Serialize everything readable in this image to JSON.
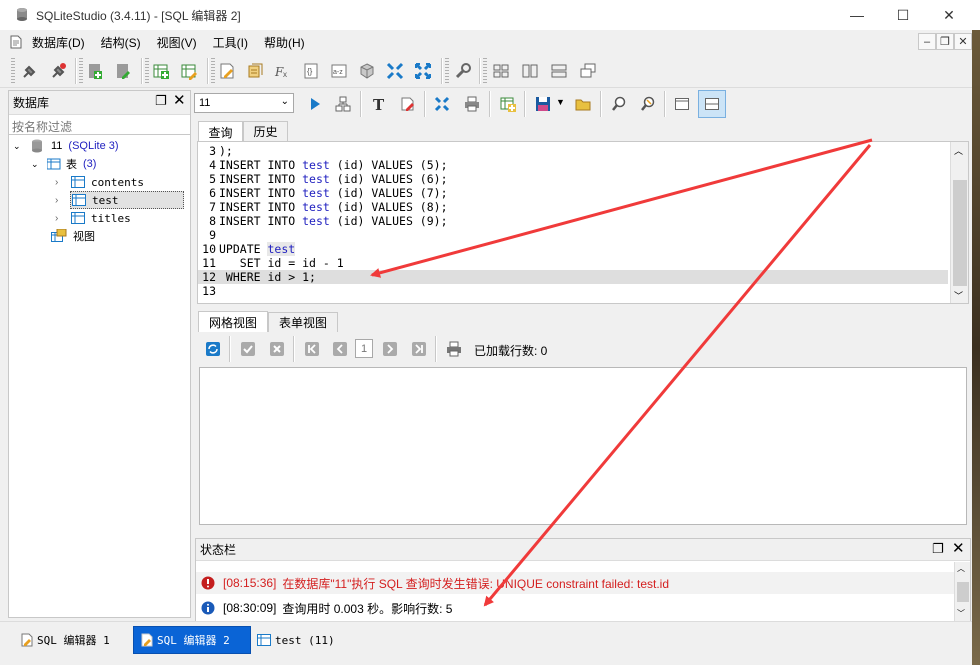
{
  "window": {
    "title": "SQLiteStudio (3.4.11) - [SQL 编辑器 2]",
    "minimize": "—",
    "maximize": "☐",
    "close": "✕"
  },
  "menu": {
    "items": [
      "数据库(D)",
      "结构(S)",
      "视图(V)",
      "工具(I)",
      "帮助(H)"
    ]
  },
  "db_panel": {
    "title": "数据库",
    "filter_placeholder": "按名称过滤",
    "db_name": "11",
    "db_type": "(SQLite 3)",
    "tables_label": "表",
    "tables_count": "(3)",
    "tables": [
      "contents",
      "test",
      "titles"
    ],
    "views_label": "视图"
  },
  "editor": {
    "db_select": "11",
    "tabs": [
      "查询",
      "历史"
    ],
    "code_lines": [
      {
        "n": "3",
        "parts": [
          [
            "kw",
            ");"
          ]
        ]
      },
      {
        "n": "4",
        "parts": [
          [
            "kw",
            "INSERT INTO "
          ],
          [
            "tbl",
            "test"
          ],
          [
            "kw",
            " (id) VALUES (5);"
          ]
        ]
      },
      {
        "n": "5",
        "parts": [
          [
            "kw",
            "INSERT INTO "
          ],
          [
            "tbl",
            "test"
          ],
          [
            "kw",
            " (id) VALUES (6);"
          ]
        ]
      },
      {
        "n": "6",
        "parts": [
          [
            "kw",
            "INSERT INTO "
          ],
          [
            "tbl",
            "test"
          ],
          [
            "kw",
            " (id) VALUES (7);"
          ]
        ]
      },
      {
        "n": "7",
        "parts": [
          [
            "kw",
            "INSERT INTO "
          ],
          [
            "tbl",
            "test"
          ],
          [
            "kw",
            " (id) VALUES (8);"
          ]
        ]
      },
      {
        "n": "8",
        "parts": [
          [
            "kw",
            "INSERT INTO "
          ],
          [
            "tbl",
            "test"
          ],
          [
            "kw",
            " (id) VALUES (9);"
          ]
        ]
      },
      {
        "n": "9",
        "parts": []
      },
      {
        "n": "10",
        "parts": [
          [
            "kw",
            "UPDATE "
          ],
          [
            "tbl",
            "test"
          ]
        ]
      },
      {
        "n": "11",
        "parts": [
          [
            "kw",
            "   SET id = id - 1"
          ]
        ]
      },
      {
        "n": "12",
        "parts": [
          [
            "kw",
            " WHERE id > 1;"
          ]
        ]
      },
      {
        "n": "13",
        "parts": []
      }
    ]
  },
  "results": {
    "tabs": [
      "网格视图",
      "表单视图"
    ],
    "page_number": "1",
    "rows_loaded": "已加载行数: 0"
  },
  "status": {
    "title": "状态栏",
    "messages": [
      {
        "time": "[08:15:36]",
        "text": "在数据库\"11\"执行 SQL 查询时发生错误: UNIQUE constraint failed: test.id",
        "level": "error"
      },
      {
        "time": "[08:30:09]",
        "text": "查询用时 0.003 秒。影响行数: 5",
        "level": "info"
      }
    ]
  },
  "taskbar": {
    "items": [
      "SQL 编辑器 1",
      "SQL 编辑器 2",
      "test (11)"
    ]
  },
  "colors": {
    "accent": "#0a64d6",
    "error": "#d42020",
    "table_name": "#1f1fbf",
    "arrow": "#f03a3a"
  }
}
